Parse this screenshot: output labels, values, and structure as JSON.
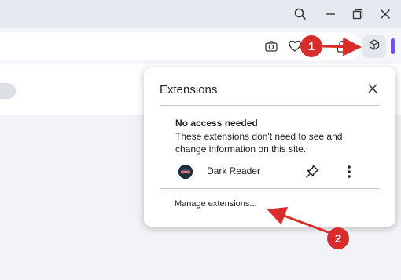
{
  "window_controls": {
    "search_icon": "search-icon",
    "minimize_icon": "minimize-icon",
    "restore_icon": "restore-icon",
    "close_icon": "close-icon"
  },
  "toolbar": {
    "icons": [
      "camera-icon",
      "heart-icon",
      "lock-icon",
      "extensions-icon"
    ],
    "accent_color": "#7c4dff"
  },
  "popup": {
    "title": "Extensions",
    "section_title": "No access needed",
    "section_description": "These extensions don't need to see and change information on this site.",
    "extensions": [
      {
        "name": "Dark Reader"
      }
    ],
    "manage_link": "Manage extensions..."
  },
  "annotations": {
    "badge_1": "1",
    "badge_2": "2",
    "annotation_color": "#d92d2d"
  }
}
